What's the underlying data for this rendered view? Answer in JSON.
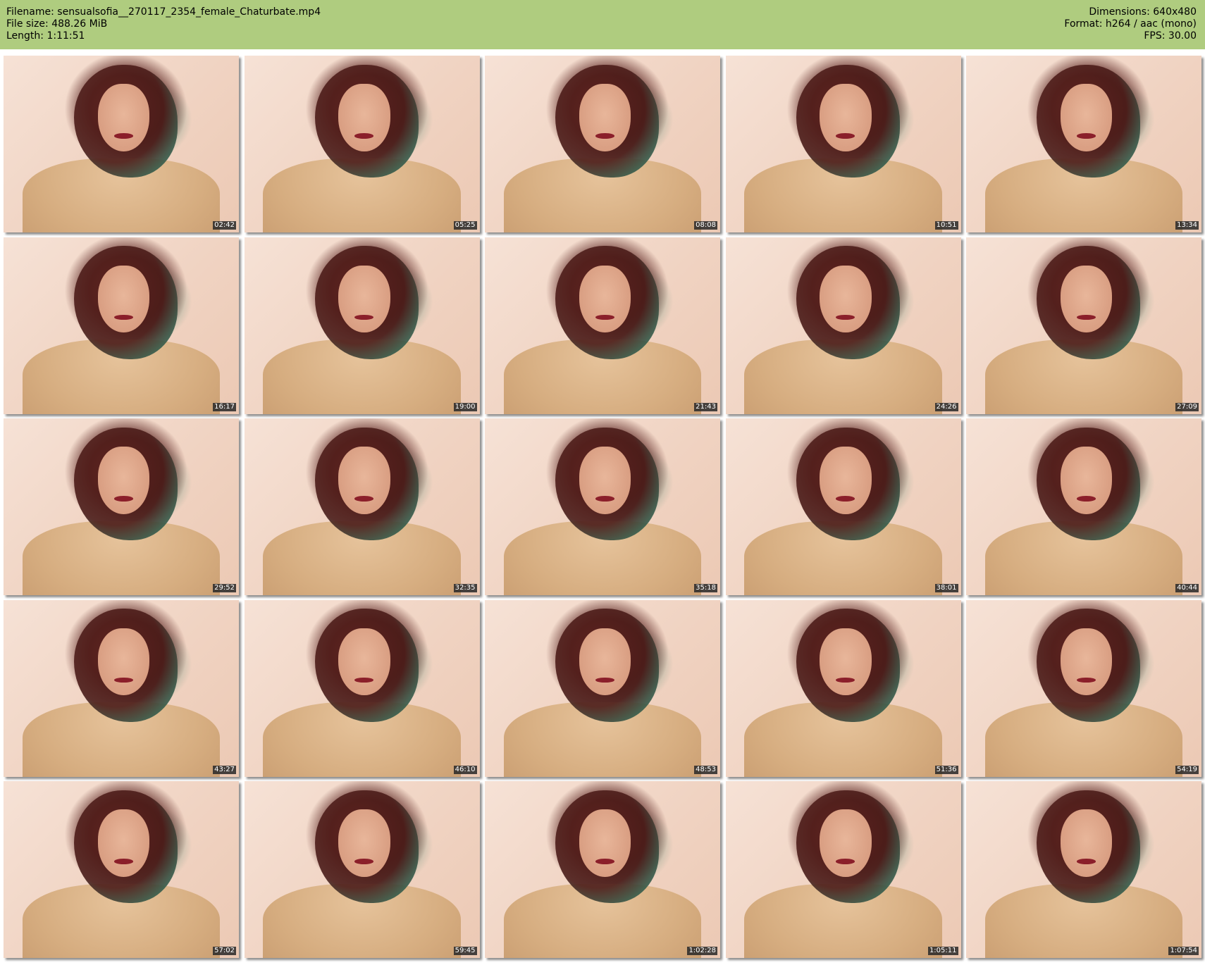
{
  "header": {
    "filename": "Filename: sensualsofia__270117_2354_female_Chaturbate.mp4",
    "filesize": "File size: 488.26 MiB",
    "length": "Length: 1:11:51",
    "dimensions": "Dimensions: 640x480",
    "format": "Format: h264 / aac (mono)",
    "fps": "FPS: 30.00"
  },
  "thumbnails": [
    {
      "timestamp": "02:42"
    },
    {
      "timestamp": "05:25"
    },
    {
      "timestamp": "08:08"
    },
    {
      "timestamp": "10:51"
    },
    {
      "timestamp": "13:34"
    },
    {
      "timestamp": "16:17"
    },
    {
      "timestamp": "19:00"
    },
    {
      "timestamp": "21:43"
    },
    {
      "timestamp": "24:26"
    },
    {
      "timestamp": "27:09"
    },
    {
      "timestamp": "29:52"
    },
    {
      "timestamp": "32:35"
    },
    {
      "timestamp": "35:18"
    },
    {
      "timestamp": "38:01"
    },
    {
      "timestamp": "40:44"
    },
    {
      "timestamp": "43:27"
    },
    {
      "timestamp": "46:10"
    },
    {
      "timestamp": "48:53"
    },
    {
      "timestamp": "51:36"
    },
    {
      "timestamp": "54:19"
    },
    {
      "timestamp": "57:02"
    },
    {
      "timestamp": "59:45"
    },
    {
      "timestamp": "1:02:28"
    },
    {
      "timestamp": "1:05:11"
    },
    {
      "timestamp": "1:07:54"
    }
  ],
  "colors": {
    "header_bg": "#afcc7f",
    "timestamp_bg": "#282828"
  }
}
